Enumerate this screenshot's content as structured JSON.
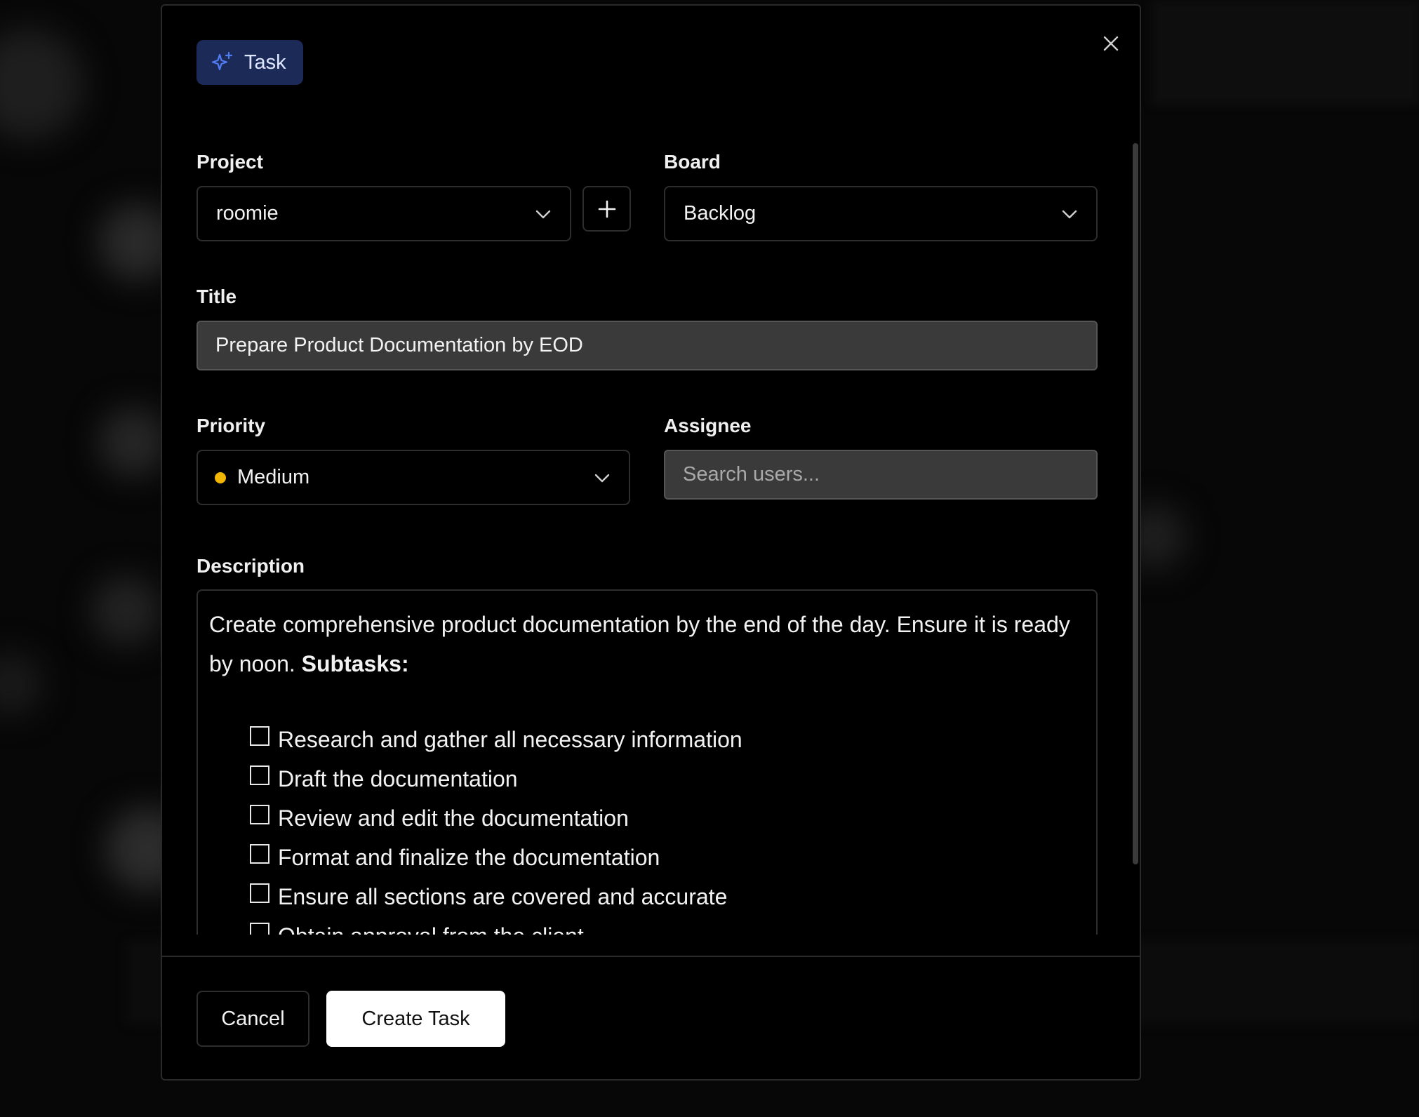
{
  "modal": {
    "type_badge": "Task",
    "close_icon": "close-icon"
  },
  "project": {
    "label": "Project",
    "value": "roomie"
  },
  "board": {
    "label": "Board",
    "value": "Backlog"
  },
  "title_field": {
    "label": "Title",
    "value": "Prepare Product Documentation by EOD"
  },
  "priority": {
    "label": "Priority",
    "value": "Medium",
    "dot_color": "#f2b705"
  },
  "assignee": {
    "label": "Assignee",
    "placeholder": "Search users..."
  },
  "description": {
    "label": "Description",
    "intro": "Create comprehensive product documentation by the end of the day. Ensure it is ready by noon. ",
    "subtasks_heading": "Subtasks:",
    "subtasks": [
      "Research and gather all necessary information",
      "Draft the documentation",
      "Review and edit the documentation",
      "Format and finalize the documentation",
      "Ensure all sections are covered and accurate",
      "Obtain approval from the client"
    ]
  },
  "footer": {
    "cancel_label": "Cancel",
    "create_label": "Create Task"
  },
  "colors": {
    "badge_bg": "#1b2a57",
    "badge_icon": "#4f7cf3"
  }
}
